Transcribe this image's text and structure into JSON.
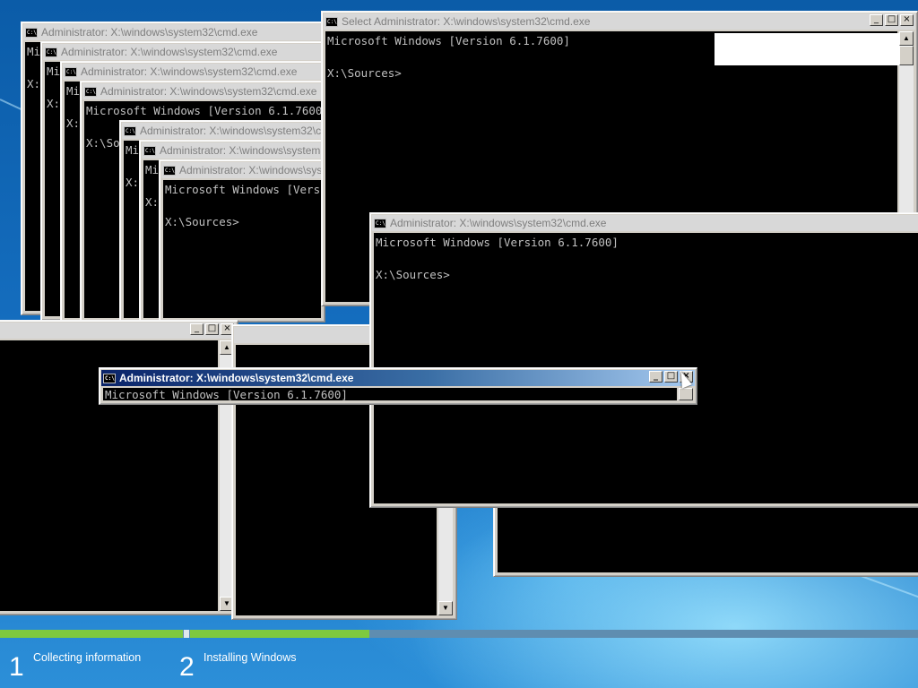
{
  "cmd_title": "Administrator: X:\\windows\\system32\\cmd.exe",
  "select_title": "Select Administrator: X:\\windows\\system32\\cmd.exe",
  "console_line1": "Microsoft Windows [Version 6.1.7600]",
  "console_prompt": "X:\\Sources>",
  "console_fragment_mi": "Mi",
  "console_fragment_x": "X:",
  "console_fragment_xso": "X:\\So",
  "icon_label": "C:\\",
  "buttons": {
    "minimize": "_",
    "maximize": "□",
    "close": "×"
  },
  "scroll": {
    "up": "▲",
    "down": "▼"
  },
  "setup": {
    "steps": [
      {
        "number": "1",
        "label": "Collecting information"
      },
      {
        "number": "2",
        "label": "Installing Windows"
      }
    ]
  },
  "colors": {
    "progress": "#7ec93f",
    "title_active": "#0a246a",
    "console_bg": "#000000",
    "console_text": "#c0c0c0"
  }
}
